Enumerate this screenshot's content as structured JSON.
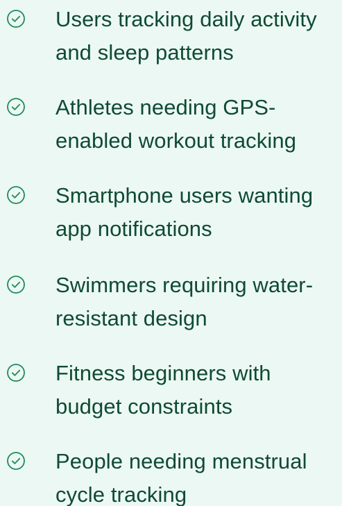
{
  "accent_color": "#1f8a5b",
  "text_color": "#0f4a35",
  "background_color": "#ecf8f3",
  "items": [
    {
      "icon": "check-circle-icon",
      "text": "Users tracking daily activity\nand sleep patterns"
    },
    {
      "icon": "check-circle-icon",
      "text": "Athletes needing GPS-\nenabled workout tracking"
    },
    {
      "icon": "check-circle-icon",
      "text": "Smartphone users wanting\napp notifications"
    },
    {
      "icon": "check-circle-icon",
      "text": "Swimmers requiring water-\nresistant design"
    },
    {
      "icon": "check-circle-icon",
      "text": "Fitness beginners with\nbudget constraints"
    },
    {
      "icon": "check-circle-icon",
      "text": "People needing menstrual\ncycle tracking"
    }
  ]
}
